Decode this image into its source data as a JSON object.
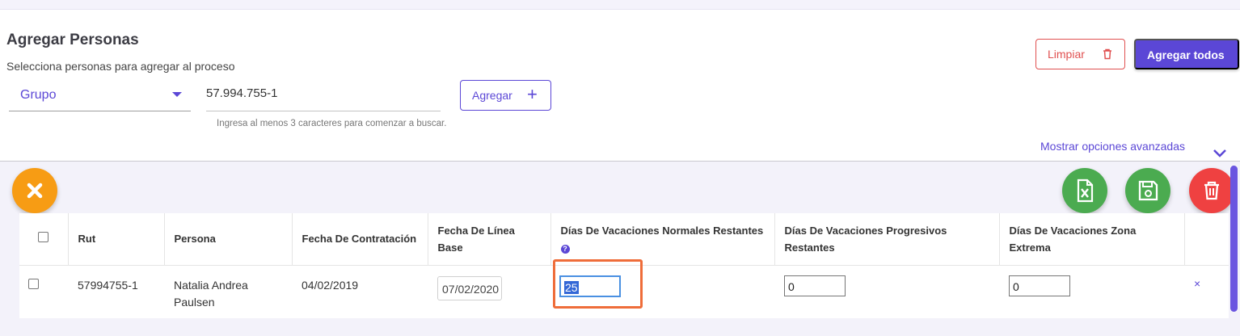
{
  "header": {
    "title": "Agregar Personas",
    "subtitle": "Selecciona personas para agregar al proceso"
  },
  "filters": {
    "group_select_value": "Grupo",
    "search_value": "57.994.755-1",
    "search_hint": "Ingresa al menos 3 caracteres para comenzar a buscar.",
    "add_button": "Agregar"
  },
  "actions": {
    "clear_button": "Limpiar",
    "add_all_button": "Agregar todos",
    "advanced_options": "Mostrar opciones avanzadas"
  },
  "fab_buttons": [
    {
      "name": "close",
      "icon": "close-icon",
      "color": "#f79c14"
    },
    {
      "name": "export-excel",
      "icon": "excel-icon",
      "color": "#4bab50"
    },
    {
      "name": "save",
      "icon": "save-icon",
      "color": "#4bab50"
    },
    {
      "name": "delete",
      "icon": "trash-icon",
      "color": "#ef4141"
    }
  ],
  "table": {
    "columns": [
      "",
      "Rut",
      "Persona",
      "Fecha De Contratación",
      "Fecha De Línea Base",
      "Días De Vacaciones Normales Restantes",
      "Días De Vacaciones Progresivos Restantes",
      "Días De Vacaciones Zona Extrema",
      ""
    ],
    "rows": [
      {
        "rut": "57994755-1",
        "persona": "Natalia Andrea Paulsen",
        "fecha_contratacion": "04/02/2019",
        "fecha_linea_base": "07/02/2020",
        "dias_normales": "25",
        "dias_progresivos": "0",
        "dias_zona_extrema": "0",
        "remove": "×"
      }
    ]
  },
  "colors": {
    "primary": "#5b47d6",
    "danger": "#e05050",
    "success": "#4bab50",
    "warning": "#f79c14",
    "highlight": "#ef6d3a"
  }
}
